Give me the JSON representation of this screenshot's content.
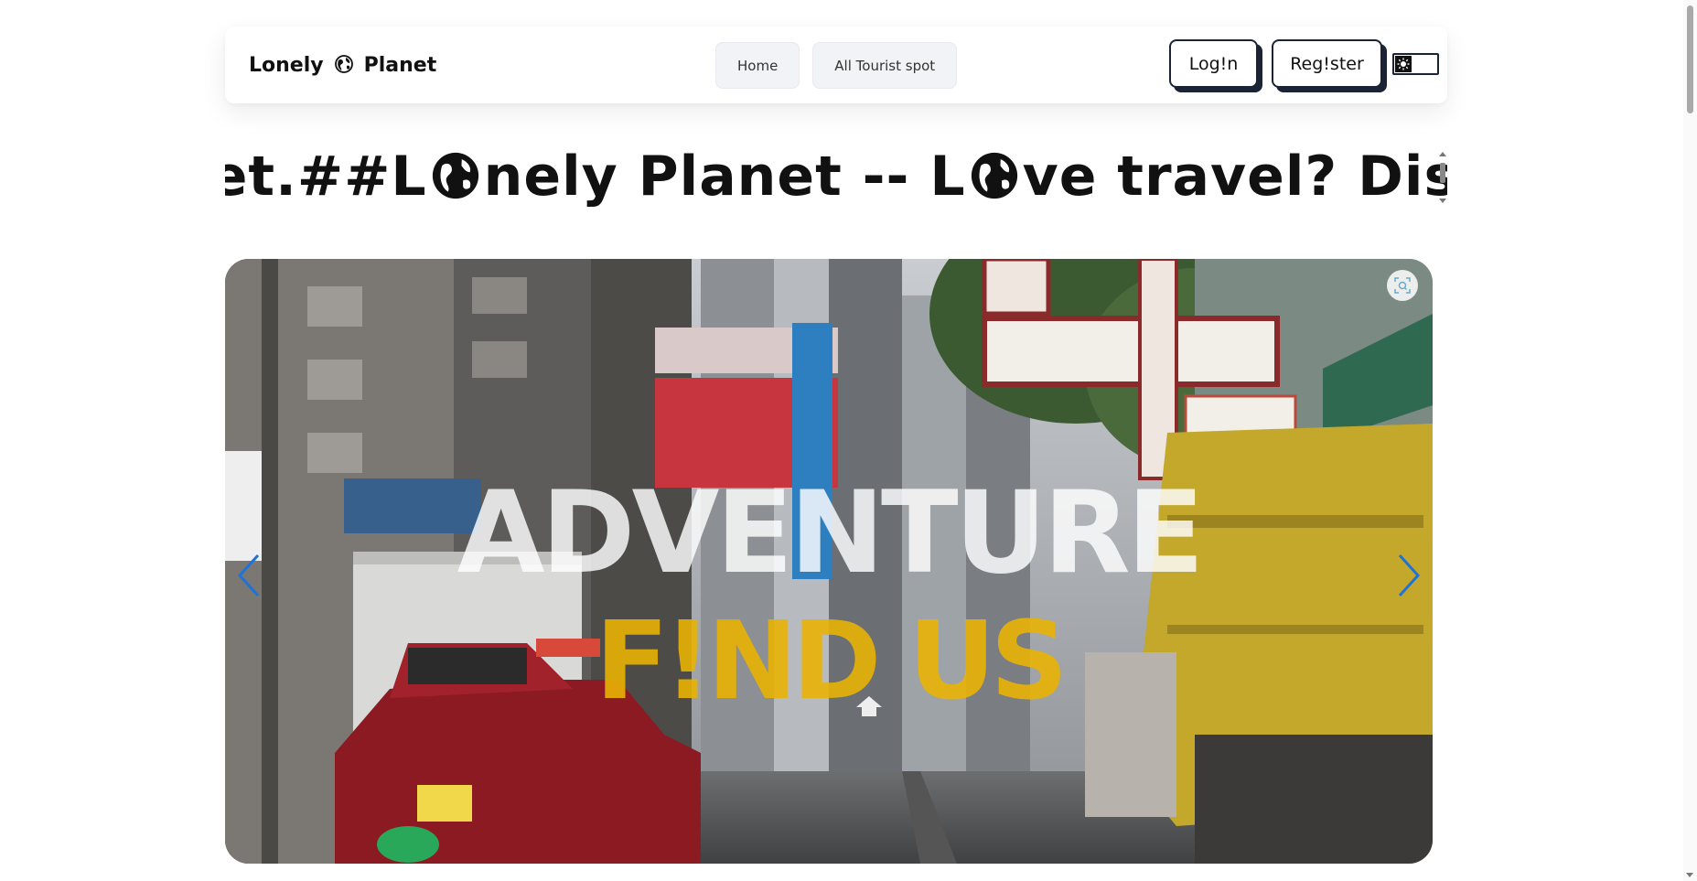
{
  "brand": {
    "word_left": "Lonely",
    "word_right": "Planet"
  },
  "nav": {
    "items": [
      {
        "label": "Home"
      },
      {
        "label": "All Tourist spot"
      }
    ]
  },
  "auth": {
    "login_label": "Log!n",
    "register_label": "Reg!ster"
  },
  "theme_toggle": {
    "icon": "sun-icon"
  },
  "marquee": {
    "segments": [
      "net.##L",
      "nely Planet -- L",
      "ve travel? Disc"
    ]
  },
  "hero": {
    "title": "ADVENTURE",
    "subtitle": "F!ND US",
    "subtitle_color": "#e8b204",
    "prev_icon": "chevron-left-icon",
    "next_icon": "chevron-right-icon",
    "arrow_color": "#1e73d9",
    "zoom_icon": "zoom-icon"
  }
}
